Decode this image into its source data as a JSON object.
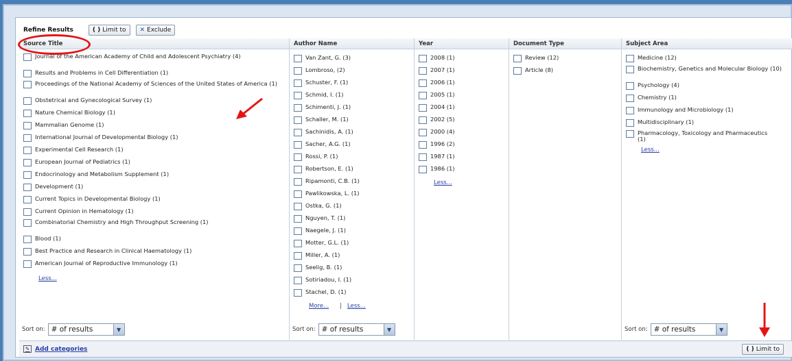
{
  "refine": {
    "title": "Refine Results",
    "limit_label": "Limit to",
    "exclude_label": "Exclude"
  },
  "columns": {
    "source": {
      "header": "Source Title",
      "items": [
        "Journal of the American Academy of Child and Adolescent Psychiatry (4)",
        "Results and Problems in Cell Differentiation (1)",
        "Proceedings of the National Academy of Sciences of the United States of America (1)",
        "Obstetrical and Gynecological Survey (1)",
        "Nature Chemical Biology (1)",
        "Mammalian Genome (1)",
        "International Journal of Developmental Biology (1)",
        "Experimental Cell Research (1)",
        "European Journal of Pediatrics (1)",
        "Endocrinology and Metabolism Supplement (1)",
        "Development (1)",
        "Current Topics in Developmental Biology (1)",
        "Current Opinion in Hematology (1)",
        "Combinatorial Chemistry and High Throughput Screening (1)",
        "Blood (1)",
        "Best Practice and Research in Clinical Haematology (1)",
        "American Journal of Reproductive Immunology (1)"
      ],
      "less": "Less..."
    },
    "author": {
      "header": "Author Name",
      "items": [
        "Van Zant, G. (3)",
        "Lombroso,  (2)",
        "Schuster, F. (1)",
        "Schmid, I. (1)",
        "Schimenti, J. (1)",
        "Schaller, M. (1)",
        "Sachinidis, A. (1)",
        "Sacher, A.G. (1)",
        "Rossi, P. (1)",
        "Robertson, E. (1)",
        "Ripamonti, C.B. (1)",
        "Pawlikowska, L. (1)",
        "Ostka, G. (1)",
        "Nguyen, T. (1)",
        "Naegele, J. (1)",
        "Motter, G.L. (1)",
        "Miller, A. (1)",
        "Seelig, B. (1)",
        "Sotiriadou, I. (1)",
        "Stachel, D. (1)"
      ],
      "more": "More...",
      "separator": "|",
      "less": "Less..."
    },
    "year": {
      "header": "Year",
      "items": [
        "2008 (1)",
        "2007 (1)",
        "2006 (1)",
        "2005 (1)",
        "2004 (1)",
        "2002 (5)",
        "2000 (4)",
        "1996 (2)",
        "1987 (1)",
        "1986 (1)"
      ],
      "less": "Less..."
    },
    "doctype": {
      "header": "Document Type",
      "items": [
        "Review (12)",
        "Article (8)"
      ]
    },
    "subject": {
      "header": "Subject Area",
      "items": [
        "Medicine (12)",
        "Biochemistry, Genetics and Molecular Biology (10)",
        "Psychology (4)",
        "Chemistry (1)",
        "Immunology and Microbiology (1)",
        "Multidisciplinary (1)",
        "Pharmacology, Toxicology and Pharmaceutics (1)"
      ],
      "less": "Less..."
    }
  },
  "sort": {
    "label": "Sort on:",
    "value": "# of results"
  },
  "bottom": {
    "add_categories": "Add categories",
    "limit_label": "Limit to"
  },
  "colors": {
    "annotation_red": "#e41414",
    "link_blue": "#2a3fa8",
    "frame_blue": "#4a7fb6"
  }
}
